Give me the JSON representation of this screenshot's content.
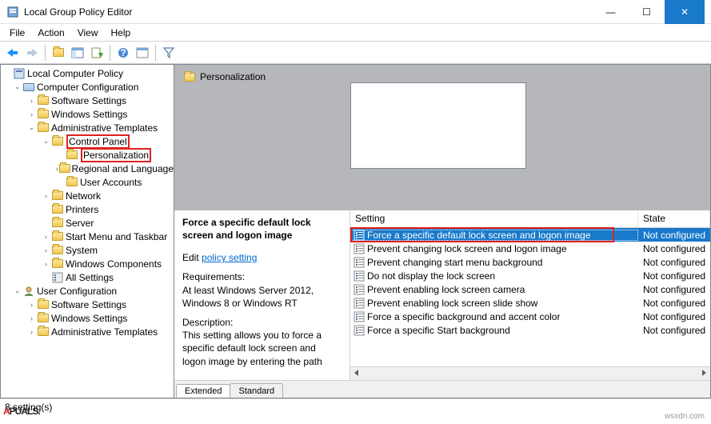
{
  "window": {
    "title": "Local Group Policy Editor",
    "min": "—",
    "max": "☐",
    "close": "✕"
  },
  "menu": {
    "file": "File",
    "action": "Action",
    "view": "View",
    "help": "Help"
  },
  "tree": {
    "root": "Local Computer Policy",
    "cc": "Computer Configuration",
    "ss": "Software Settings",
    "ws": "Windows Settings",
    "at": "Administrative Templates",
    "cp": "Control Panel",
    "pers": "Personalization",
    "rl": "Regional and Language",
    "ua": "User Accounts",
    "net": "Network",
    "prn": "Printers",
    "srv": "Server",
    "smt": "Start Menu and Taskbar",
    "sys": "System",
    "wc": "Windows Components",
    "as": "All Settings",
    "uc": "User Configuration",
    "ss2": "Software Settings",
    "ws2": "Windows Settings",
    "at2": "Administrative Templates"
  },
  "header": {
    "crumb": "Personalization"
  },
  "detail": {
    "title": "Force a specific default lock screen and logon image",
    "edit_prefix": "Edit ",
    "edit_link": "policy setting",
    "req_label": "Requirements:",
    "req_text": "At least Windows Server 2012, Windows 8 or Windows RT",
    "desc_label": "Description:",
    "desc_text": "This setting allows you to force a specific default lock screen and logon image by entering the path"
  },
  "columns": {
    "setting": "Setting",
    "state": "State"
  },
  "settings": [
    {
      "name": "Force a specific default lock screen and logon image",
      "state": "Not configured",
      "selected": true
    },
    {
      "name": "Prevent changing lock screen and logon image",
      "state": "Not configured"
    },
    {
      "name": "Prevent changing start menu background",
      "state": "Not configured"
    },
    {
      "name": "Do not display the lock screen",
      "state": "Not configured"
    },
    {
      "name": "Prevent enabling lock screen camera",
      "state": "Not configured"
    },
    {
      "name": "Prevent enabling lock screen slide show",
      "state": "Not configured"
    },
    {
      "name": "Force a specific background and accent color",
      "state": "Not configured"
    },
    {
      "name": "Force a specific Start background",
      "state": "Not configured"
    }
  ],
  "tabs": {
    "extended": "Extended",
    "standard": "Standard"
  },
  "status": {
    "text": "8 setting(s)"
  },
  "branding": {
    "logo_a": "A",
    "logo_rest": "PUALS.",
    "wsx": "wsxdn.com"
  }
}
